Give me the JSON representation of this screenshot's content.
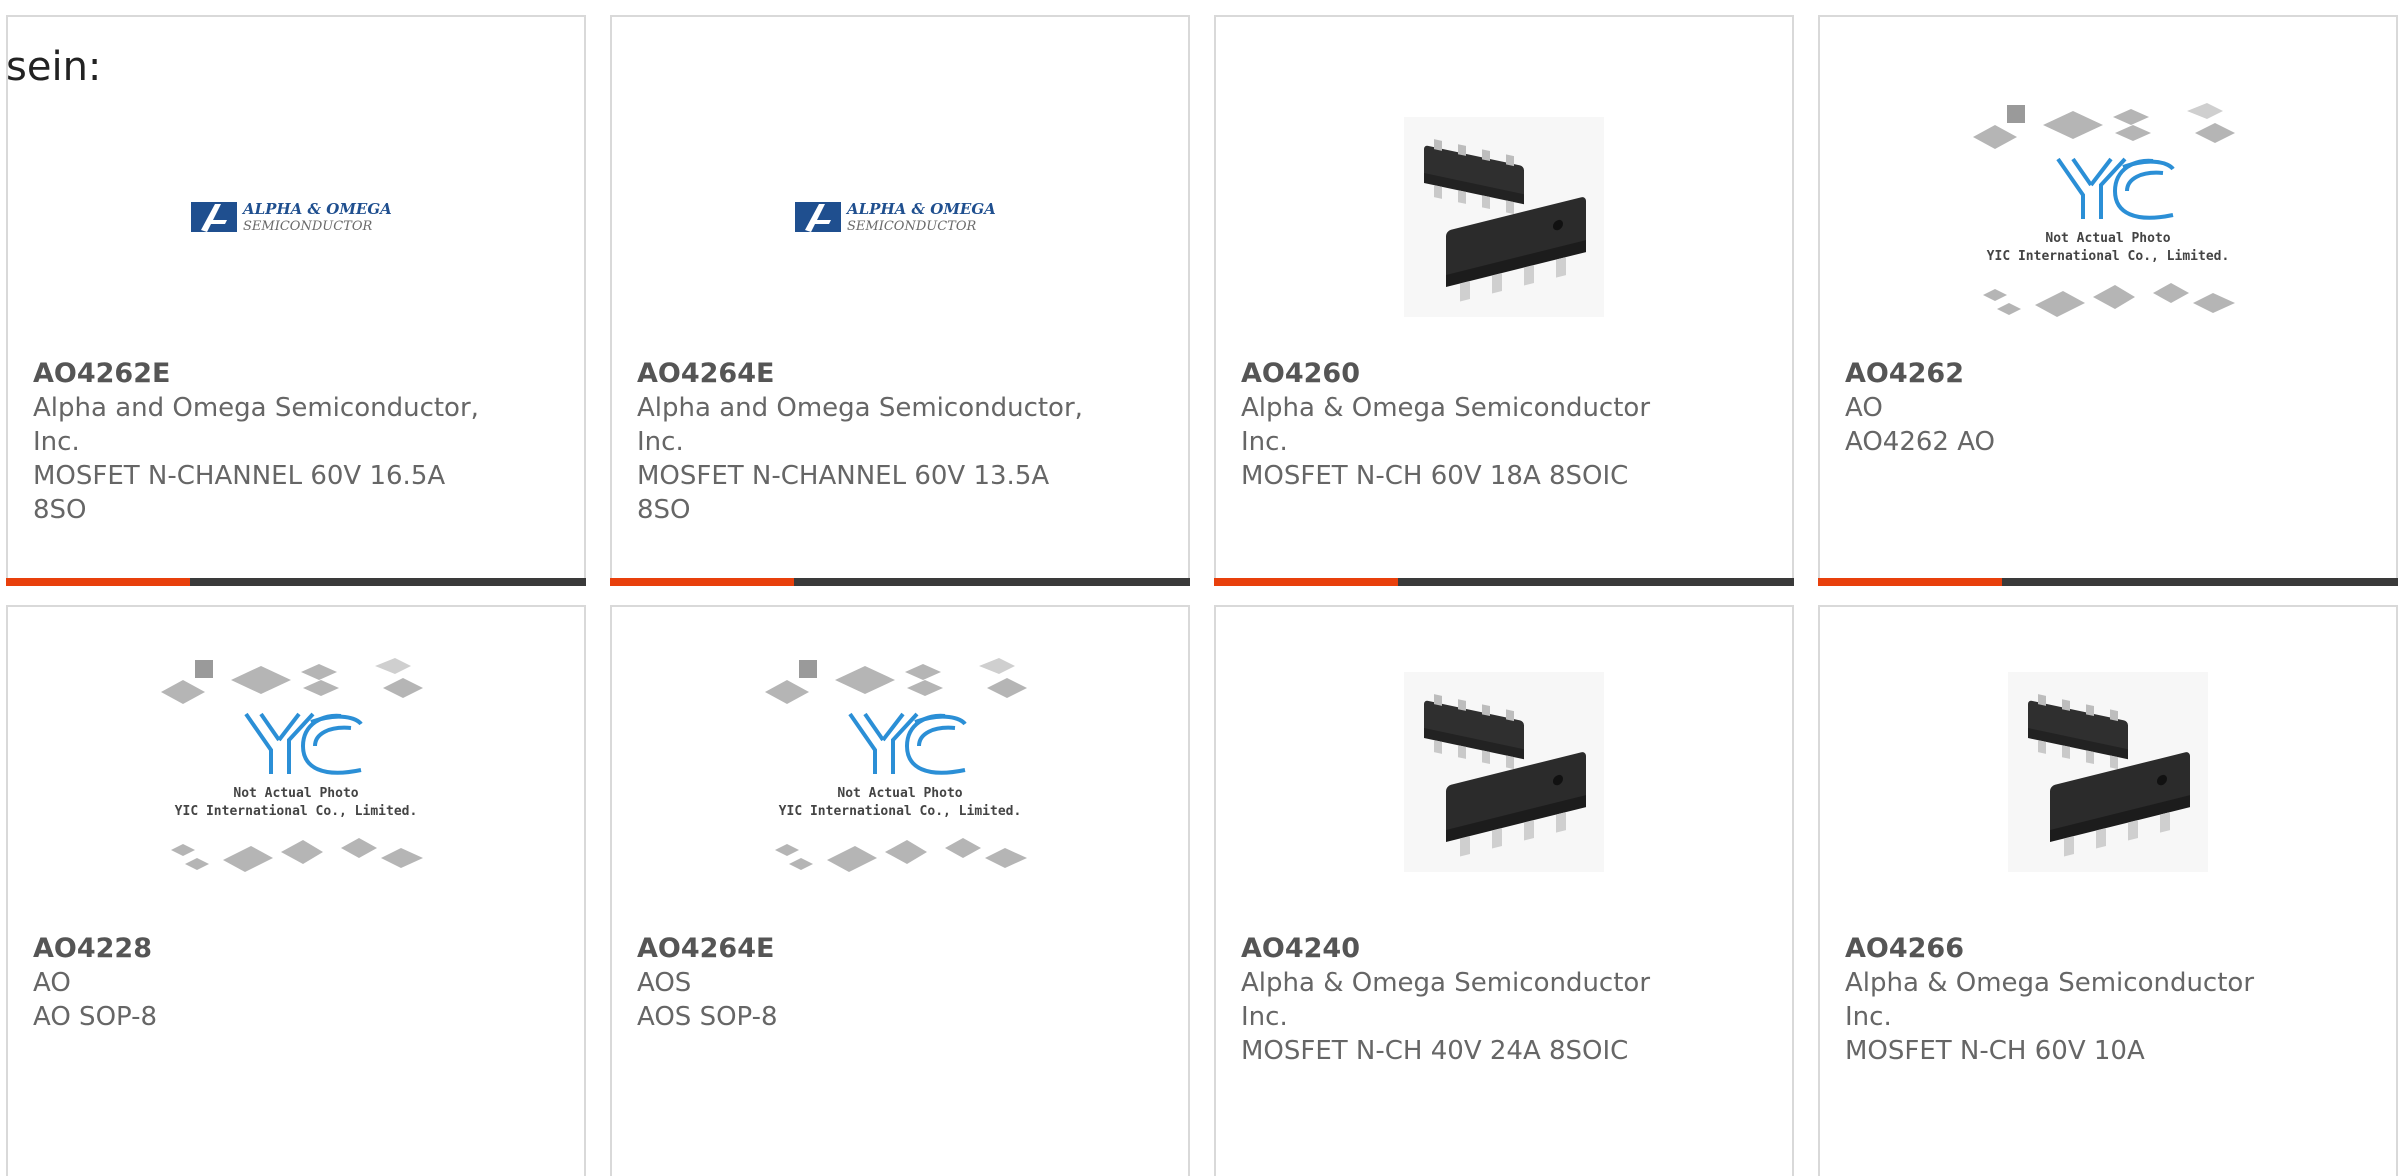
{
  "intro_text": "sein:",
  "colors": {
    "accent_orange": "#e8400c",
    "accent_dark": "#3a3a3a",
    "ao_logo_blue": "#1f4f8f",
    "yic_blue": "#2b8fd6"
  },
  "logo_texts": {
    "ao_line1": "ALPHA & OMEGA",
    "ao_line2": "SEMICONDUCTOR",
    "yic_line1": "Not Actual Photo",
    "yic_line2": "YIC International Co., Limited."
  },
  "products": [
    {
      "part_number": "AO4262E",
      "manufacturer": "Alpha and Omega Semiconductor, Inc.",
      "description": "MOSFET N-CHANNEL 60V 16.5A 8SO",
      "image": "ao-logo"
    },
    {
      "part_number": "AO4264E",
      "manufacturer": "Alpha and Omega Semiconductor, Inc.",
      "description": "MOSFET N-CHANNEL 60V 13.5A 8SO",
      "image": "ao-logo"
    },
    {
      "part_number": "AO4260",
      "manufacturer": "Alpha & Omega Semiconductor Inc.",
      "description": "MOSFET N-CH 60V 18A 8SOIC",
      "image": "soic-chip"
    },
    {
      "part_number": "AO4262",
      "manufacturer": "AO",
      "description": "AO4262 AO",
      "image": "yic-placeholder"
    },
    {
      "part_number": "AO4228",
      "manufacturer": "AO",
      "description": "AO SOP-8",
      "image": "yic-placeholder"
    },
    {
      "part_number": "AO4264E",
      "manufacturer": "AOS",
      "description": "AOS SOP-8",
      "image": "yic-placeholder"
    },
    {
      "part_number": "AO4240",
      "manufacturer": "Alpha & Omega Semiconductor Inc.",
      "description": "MOSFET N-CH 40V 24A 8SOIC",
      "image": "soic-chip"
    },
    {
      "part_number": "AO4266",
      "manufacturer": "Alpha & Omega Semiconductor Inc.",
      "description": "MOSFET N-CH 60V 10A",
      "image": "soic-chip"
    }
  ]
}
